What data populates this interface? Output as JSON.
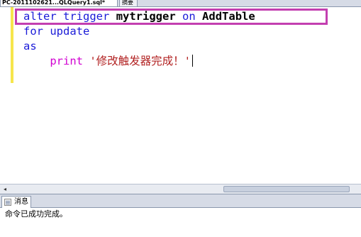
{
  "tabs": {
    "active": "PC-2011102621...QLQuery1.sql*",
    "inactive": "摘要"
  },
  "editor": {
    "line1": {
      "kw1": "alter",
      "kw2": "trigger",
      "name": "mytrigger",
      "kw3": "on",
      "table": "AddTable"
    },
    "line2": {
      "kw1": "for",
      "kw2": "update"
    },
    "line3": {
      "kw1": "as"
    },
    "line4": {
      "fn": "print",
      "str": "'修改触发器完成！'"
    }
  },
  "results": {
    "tab_label": "消息",
    "message": "命令已成功完成。"
  },
  "colors": {
    "keyword": "#1b1bd8",
    "function": "#d100d1",
    "string": "#b22222",
    "highlight_box": "#c33fb0",
    "margin_bar": "#f6e54c"
  }
}
